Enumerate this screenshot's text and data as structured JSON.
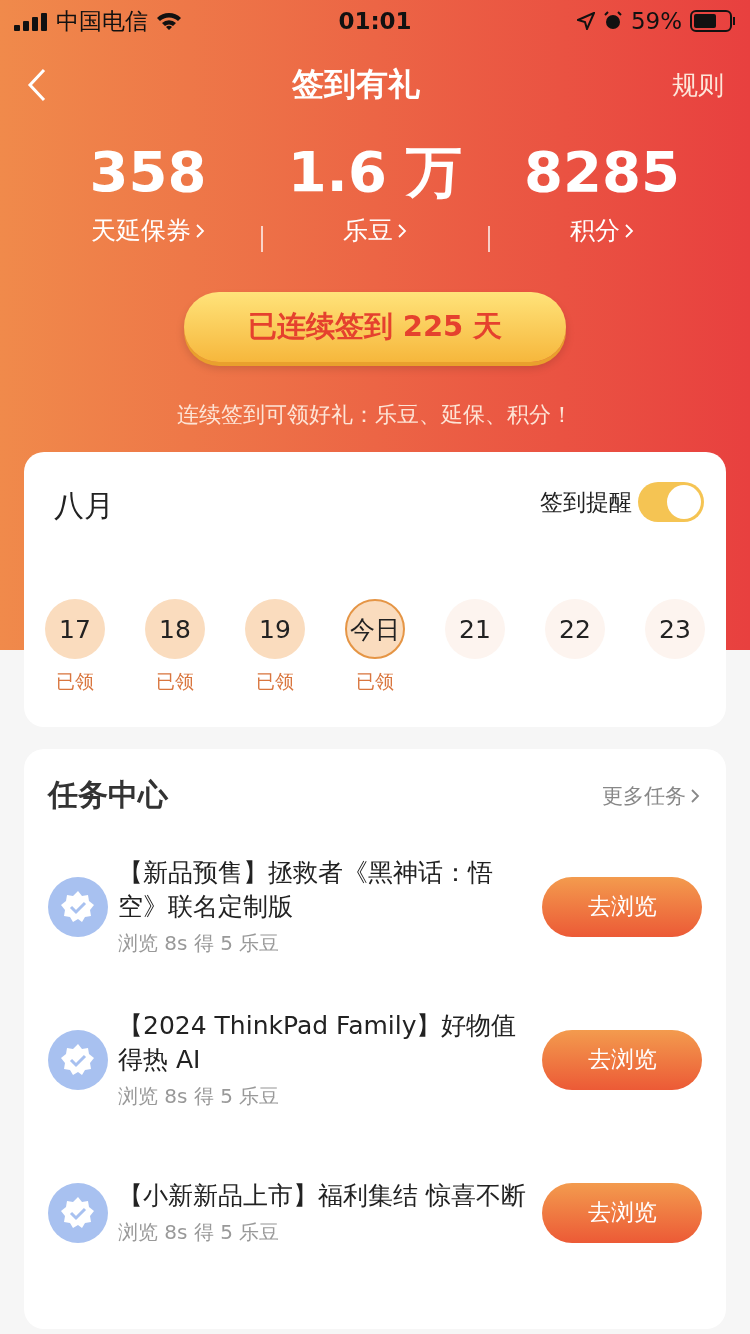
{
  "status_bar": {
    "carrier": "中国电信",
    "time": "01:01",
    "battery": "59%"
  },
  "nav": {
    "title": "签到有礼",
    "action": "规则"
  },
  "stats": [
    {
      "value": "358",
      "label": "天延保券"
    },
    {
      "value": "1.6 万",
      "label": "乐豆"
    },
    {
      "value": "8285",
      "label": "积分"
    }
  ],
  "streak_button": "已连续签到 225 天",
  "hint": "连续签到可领好礼：乐豆、延保、积分！",
  "calendar": {
    "month": "八月",
    "reminder": {
      "label": "签到提醒",
      "on": true
    },
    "days": [
      {
        "label": "17",
        "claimed": true,
        "today": false,
        "status": "已领"
      },
      {
        "label": "18",
        "claimed": true,
        "today": false,
        "status": "已领"
      },
      {
        "label": "19",
        "claimed": true,
        "today": false,
        "status": "已领"
      },
      {
        "label": "今日",
        "claimed": true,
        "today": true,
        "status": "已领"
      },
      {
        "label": "21",
        "claimed": false,
        "today": false
      },
      {
        "label": "22",
        "claimed": false,
        "today": false
      },
      {
        "label": "23",
        "claimed": false,
        "today": false
      }
    ]
  },
  "tasks": {
    "title": "任务中心",
    "more": "更多任务",
    "items": [
      {
        "title": "【新品预售】拯救者《黑神话：悟空》联名定制版",
        "reward": "浏览 8s 得 5 乐豆",
        "button": "去浏览"
      },
      {
        "title": "【2024 ThinkPad Family】好物值得热 AI",
        "reward": "浏览 8s 得 5 乐豆",
        "button": "去浏览"
      },
      {
        "title": "【小新新品上市】福利集结 惊喜不断",
        "reward": "浏览 8s 得 5 乐豆",
        "button": "去浏览"
      }
    ]
  }
}
